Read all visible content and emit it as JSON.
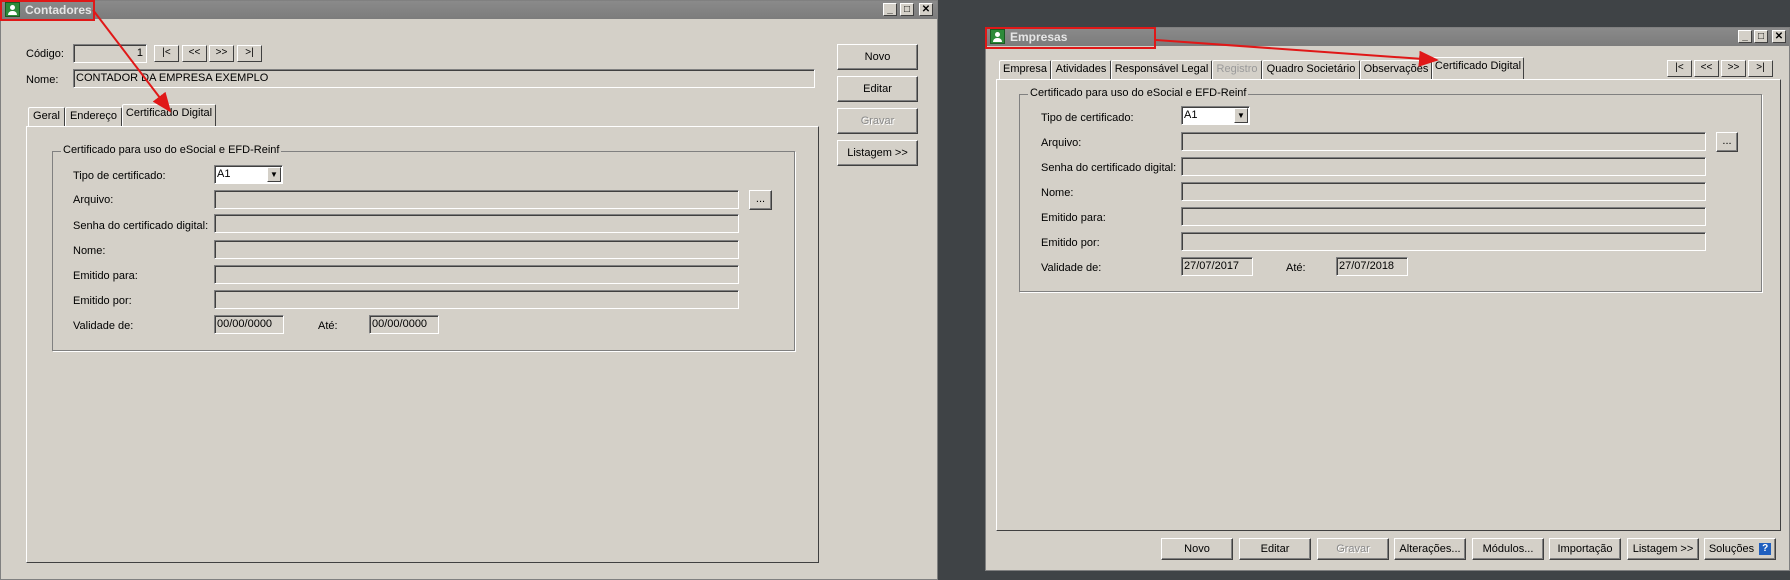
{
  "left_window": {
    "title": "Contadores",
    "codigo_label": "Código:",
    "codigo_value": "1",
    "nome_label": "Nome:",
    "nome_value": "CONTADOR DA EMPRESA EXEMPLO",
    "nav": [
      "|<",
      "<<",
      ">>",
      ">|"
    ],
    "tabs": [
      "Geral",
      "Endereço",
      "Certificado Digital"
    ],
    "group_title": "Certificado para uso do eSocial e EFD-Reinf",
    "tipo_label": "Tipo de certificado:",
    "tipo_value": "A1",
    "arquivo_label": "Arquivo:",
    "browse": "...",
    "senha_label": "Senha do certificado digital:",
    "nome2_label": "Nome:",
    "emitido_para_label": "Emitido para:",
    "emitido_por_label": "Emitido por:",
    "validade_label": "Validade de:",
    "validade_de": "00/00/0000",
    "ate_label": "Até:",
    "validade_ate": "00/00/0000",
    "buttons": {
      "novo": "Novo",
      "editar": "Editar",
      "gravar": "Gravar",
      "listagem": "Listagem >>"
    }
  },
  "right_window": {
    "title": "Empresas",
    "tabs": [
      "Empresa",
      "Atividades",
      "Responsável Legal",
      "Registro",
      "Quadro Societário",
      "Observações",
      "Certificado Digital"
    ],
    "nav": [
      "|<",
      "<<",
      ">>",
      ">|"
    ],
    "group_title": "Certificado para uso do eSocial e EFD-Reinf",
    "tipo_label": "Tipo de certificado:",
    "tipo_value": "A1",
    "arquivo_label": "Arquivo:",
    "browse": "...",
    "senha_label": "Senha do certificado digital:",
    "nome_label": "Nome:",
    "emitido_para_label": "Emitido para:",
    "emitido_por_label": "Emitido por:",
    "validade_label": "Validade de:",
    "validade_de": "27/07/2017",
    "ate_label": "Até:",
    "validade_ate": "27/07/2018",
    "buttons": {
      "novo": "Novo",
      "editar": "Editar",
      "gravar": "Gravar",
      "alteracoes": "Alterações...",
      "modulos": "Módulos...",
      "importacao": "Importação",
      "listagem": "Listagem >>",
      "solucoes": "Soluções"
    },
    "help_glyph": "?"
  },
  "window_controls": {
    "minimize": "_",
    "maximize": "□",
    "close": "✕"
  },
  "colors": {
    "highlight": "#e01818",
    "titlebar": "#808080",
    "face": "#d4d0c8"
  }
}
